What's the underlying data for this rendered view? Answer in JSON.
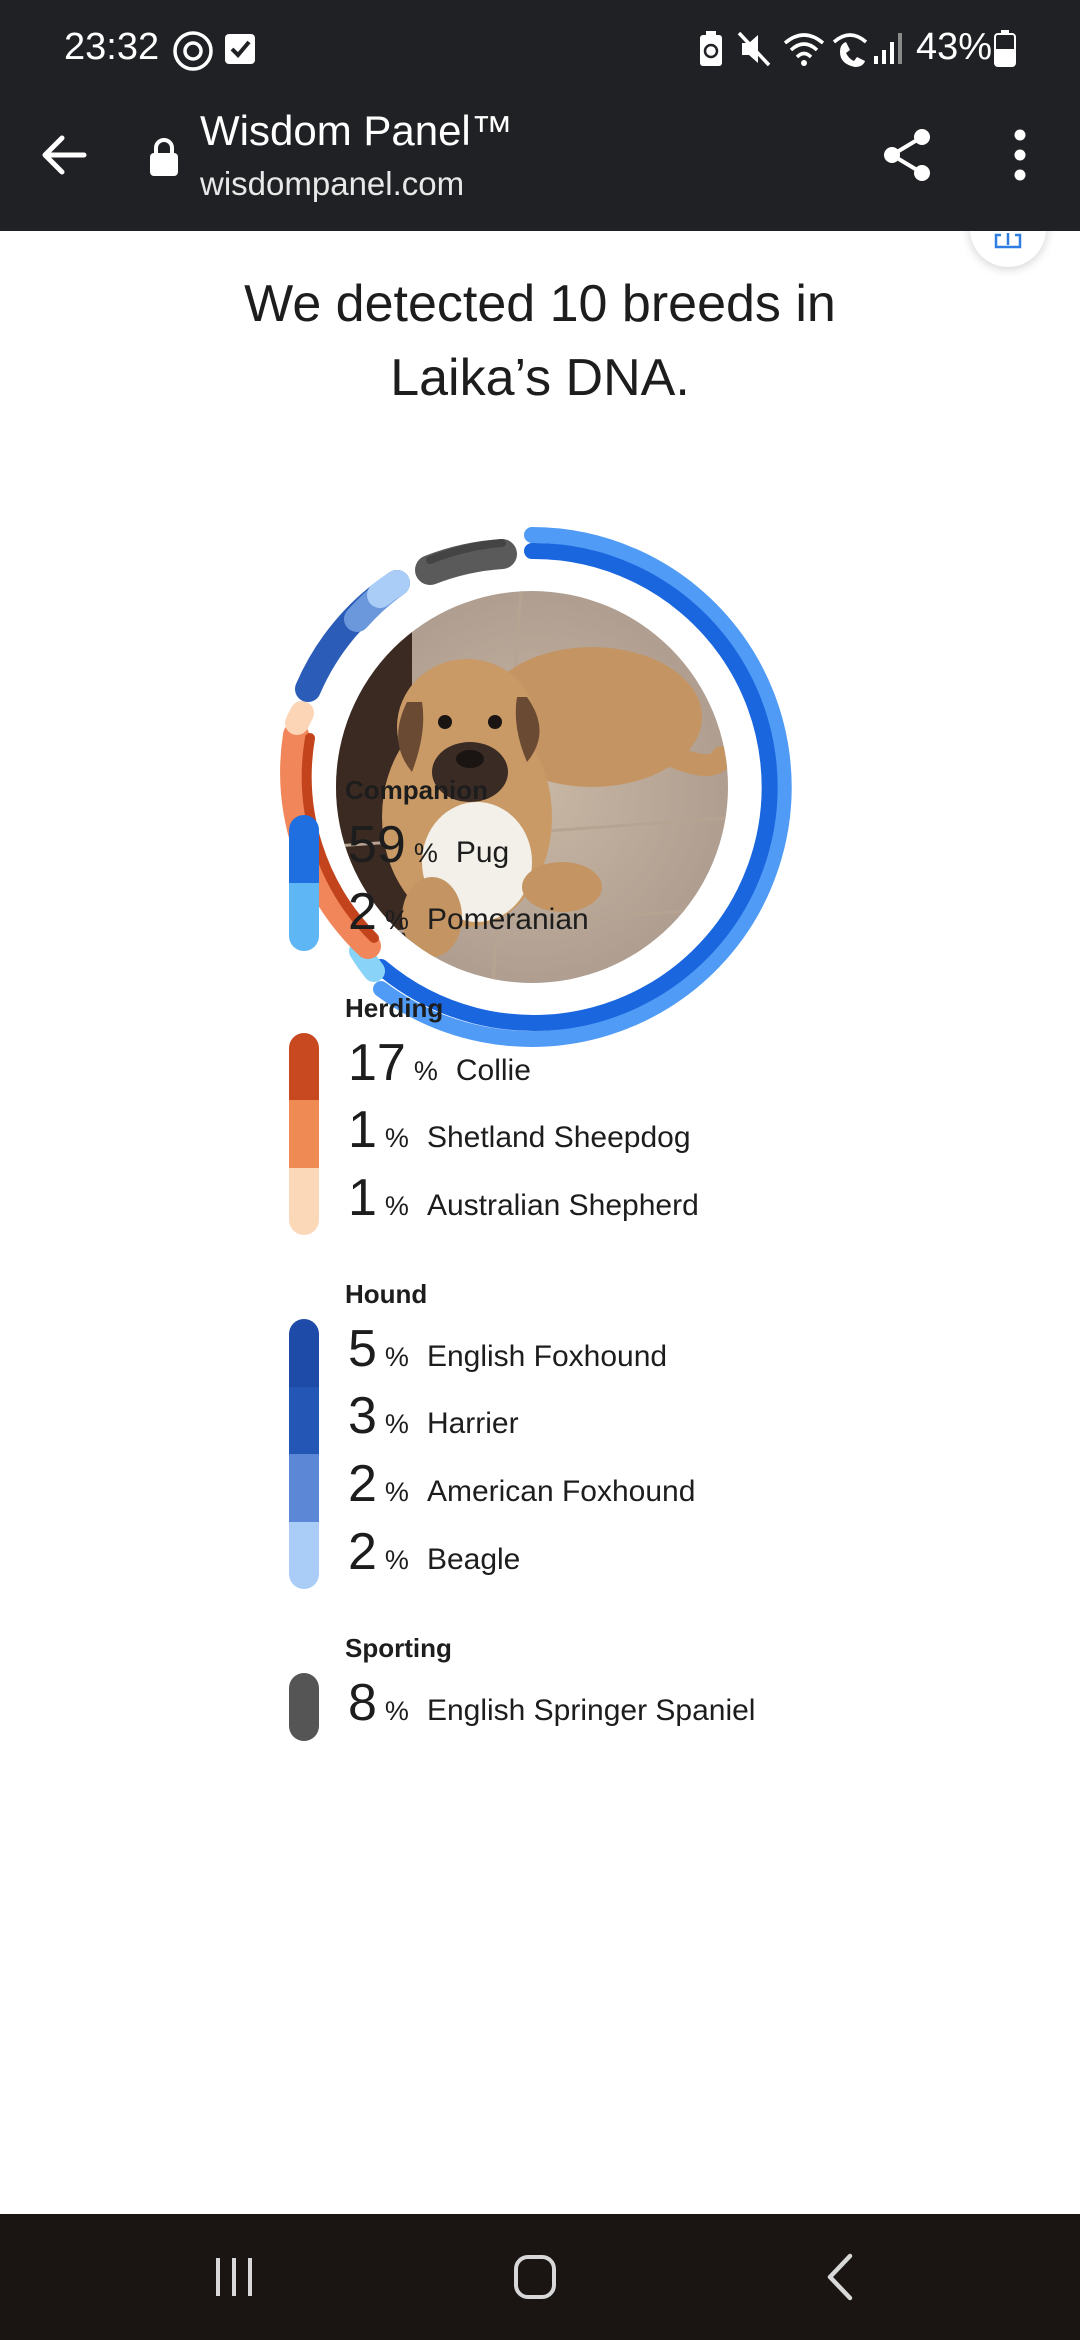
{
  "status_bar": {
    "time": "23:32",
    "battery_percent": "43%",
    "icons": [
      "threads-icon",
      "checkbox-icon",
      "battery-saver-icon",
      "mute-icon",
      "wifi-icon",
      "wifi-calling-icon",
      "signal-icon",
      "battery-icon"
    ]
  },
  "browser": {
    "site_title": "Wisdom Panel™",
    "url": "wisdompanel.com",
    "back_icon": "arrow-left-icon",
    "lock_icon": "lock-icon",
    "share_icon": "share-icon",
    "menu_icon": "more-vert-icon"
  },
  "page": {
    "headline_line1": "We detected 10 breeds in",
    "headline_line2": "Laika’s DNA.",
    "photo_alt": "dog photo"
  },
  "colors": {
    "companion": [
      "#1f6fe0",
      "#5fb6f5"
    ],
    "herding": [
      "#c8491f",
      "#f08a55",
      "#fbd8b8"
    ],
    "hound": [
      "#1e4ba8",
      "#2456b5",
      "#5c86d6",
      "#a9cdf7"
    ],
    "sporting": [
      "#555555"
    ]
  },
  "groups": [
    {
      "name": "Companion",
      "breeds": [
        {
          "pct": "59",
          "sign": "%",
          "name": "Pug"
        },
        {
          "pct": "2",
          "sign": "%",
          "name": "Pomeranian"
        }
      ]
    },
    {
      "name": "Herding",
      "breeds": [
        {
          "pct": "17",
          "sign": "%",
          "name": "Collie"
        },
        {
          "pct": "1",
          "sign": "%",
          "name": "Shetland Sheepdog"
        },
        {
          "pct": "1",
          "sign": "%",
          "name": "Australian Shepherd"
        }
      ]
    },
    {
      "name": "Hound",
      "breeds": [
        {
          "pct": "5",
          "sign": "%",
          "name": "English Foxhound"
        },
        {
          "pct": "3",
          "sign": "%",
          "name": "Harrier"
        },
        {
          "pct": "2",
          "sign": "%",
          "name": "American Foxhound"
        },
        {
          "pct": "2",
          "sign": "%",
          "name": "Beagle"
        }
      ]
    },
    {
      "name": "Sporting",
      "breeds": [
        {
          "pct": "8",
          "sign": "%",
          "name": "English Springer Spaniel"
        }
      ]
    }
  ],
  "nav": {
    "recents_icon": "recents-icon",
    "home_icon": "home-icon",
    "back_icon": "back-chevron-icon"
  }
}
